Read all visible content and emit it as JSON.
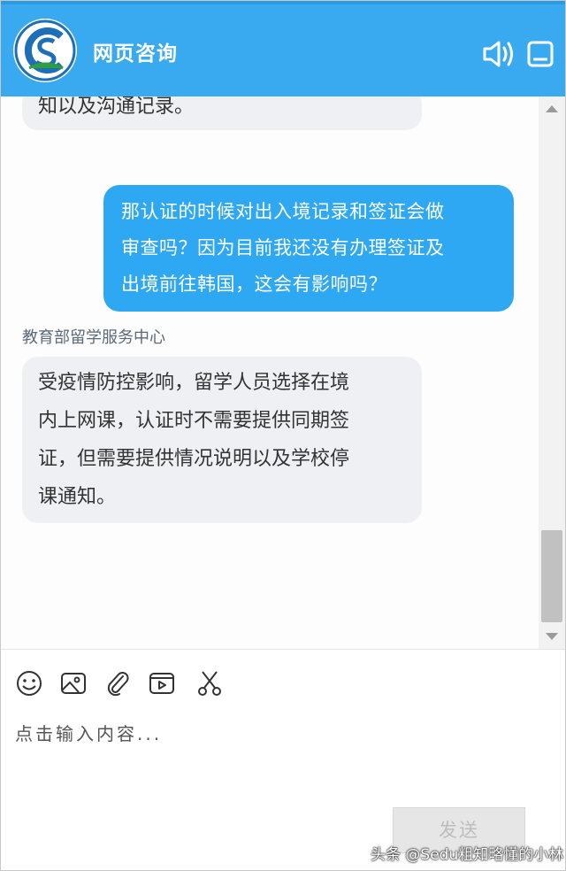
{
  "header": {
    "title": "网页咨询",
    "logo_icon": "center-logo-icon",
    "sound_icon": "speaker-icon",
    "minimize_icon": "minimize-icon"
  },
  "messages": [
    {
      "side": "left",
      "lines": [
        "知以及沟通记录。"
      ]
    },
    {
      "side": "right",
      "lines": [
        "那认证的时候对出入境记录和签证会做",
        "审查吗？因为目前我还没有办理签证及",
        "出境前往韩国，这会有影响吗？"
      ]
    },
    {
      "side": "left",
      "sender": "教育部留学服务中心",
      "lines": [
        "受疫情防控影响，留学人员选择在境",
        "内上网课，认证时不需要提供同期签",
        "证，但需要提供情况说明以及学校停",
        "课通知。"
      ]
    }
  ],
  "toolbar": {
    "icons": [
      "emoji-icon",
      "image-icon",
      "attachment-icon",
      "video-icon",
      "scissors-icon"
    ]
  },
  "input": {
    "placeholder": "点击输入内容..."
  },
  "send_label": "发送",
  "watermark": "头条 @Sedu粗知略懂的小林",
  "colors": {
    "header": "#3aaaf0",
    "user_bubble": "#2fa8f3",
    "agent_bubble": "#eef0f4"
  }
}
